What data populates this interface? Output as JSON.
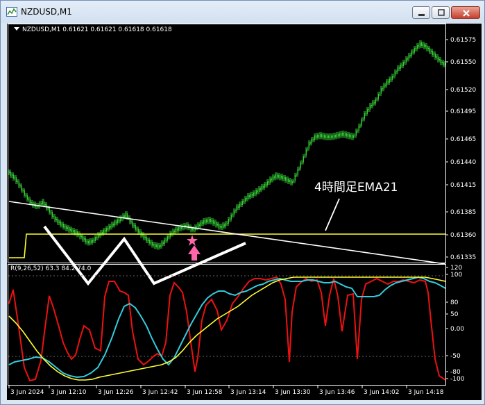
{
  "window": {
    "title": "NZDUSD,M1"
  },
  "chart": {
    "header": "NZDUSD,M1  0.61621 0.61621 0.61618 0.61618",
    "price_labels": [
      "0.61575",
      "0.61550",
      "0.61520",
      "0.61495",
      "0.61465",
      "0.61440",
      "0.61415",
      "0.61385",
      "0.61360",
      "0.61335"
    ],
    "annotation": "4時間足EMA21",
    "time_labels": [
      "3 Jun 2024",
      "3 Jun 12:10",
      "3 Jun 12:26",
      "3 Jun 12:42",
      "3 Jun 12:58",
      "3 Jun 13:14",
      "3 Jun 13:30",
      "3 Jun 13:46",
      "3 Jun 14:02",
      "3 Jun 14:18"
    ]
  },
  "indicator": {
    "label": "R(9,26,52) 63.3 84.2 74.0",
    "levels": [
      "120",
      "100",
      "80",
      "50",
      "0.00",
      "-50",
      "-80",
      "-100"
    ]
  },
  "colors": {
    "background": "#000000",
    "candles": "#33cc33",
    "ema_line": "#ffff33",
    "trendline": "#ffffff",
    "red_line": "#ee1111",
    "cyan_line": "#33ccdd",
    "yellow_line": "#ffff33",
    "arrow": "#ff66aa"
  }
}
